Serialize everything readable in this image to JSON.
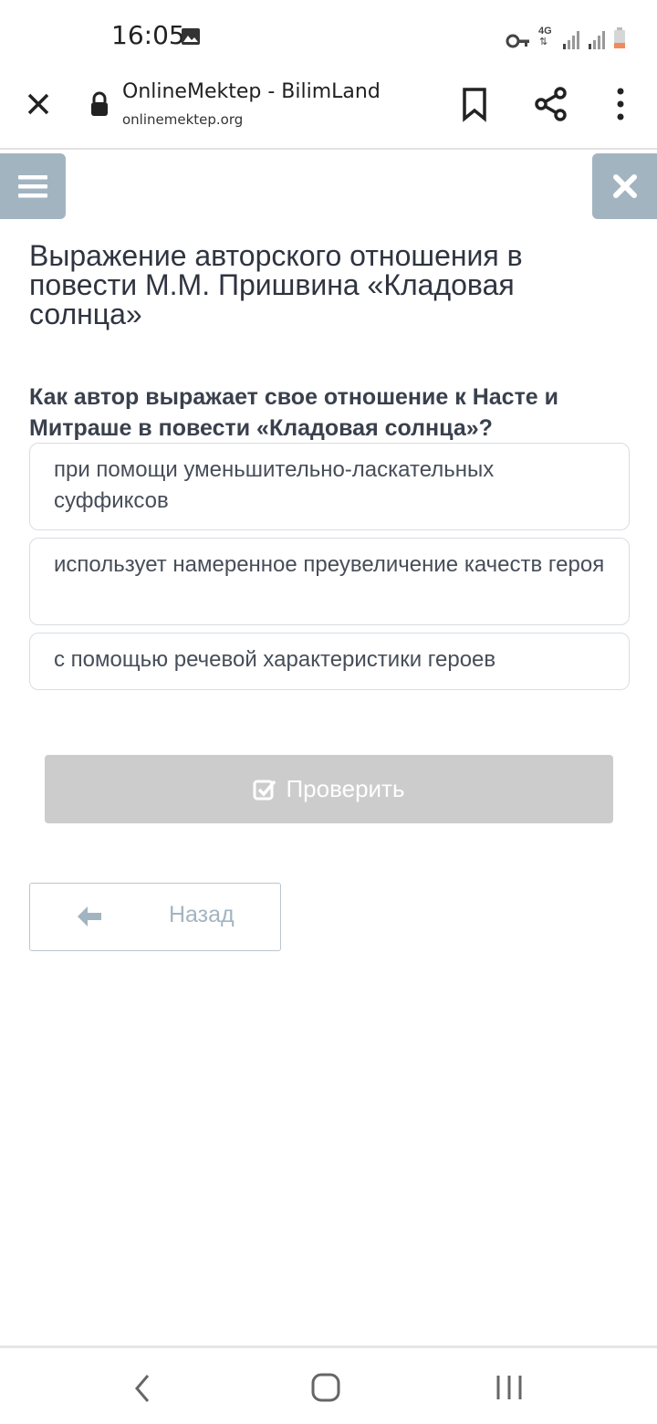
{
  "status_bar": {
    "time": "16:05",
    "network_label": "4G",
    "icons": [
      "gallery-icon",
      "vpn-key-icon",
      "network-4g-icon",
      "signal-icon",
      "signal-icon",
      "battery-icon"
    ]
  },
  "browser": {
    "page_title": "OnlineMektep - BilimLand",
    "url": "onlinemektep.org",
    "icons": [
      "close-icon",
      "lock-icon",
      "bookmark-icon",
      "share-icon",
      "more-vert-icon"
    ]
  },
  "page": {
    "lesson_title": "Выражение авторского отношения в повести М.М. Пришвина «Кладовая солнца»",
    "question": "Как автор выражает свое отношение к Насте и Митраше в повести «Кладовая солнца»?",
    "answers": [
      "при помощи уменьшительно-ласкательных суффиксов",
      "использует намеренное преувеличение качеств героя",
      "с помощью речевой характеристики героев"
    ],
    "check_label": "Проверить",
    "back_label": "Назад"
  },
  "colors": {
    "accent": "#a3b4c1",
    "disabled_button": "#cccccc",
    "text": "#2f3440",
    "border": "#d9dde2"
  }
}
